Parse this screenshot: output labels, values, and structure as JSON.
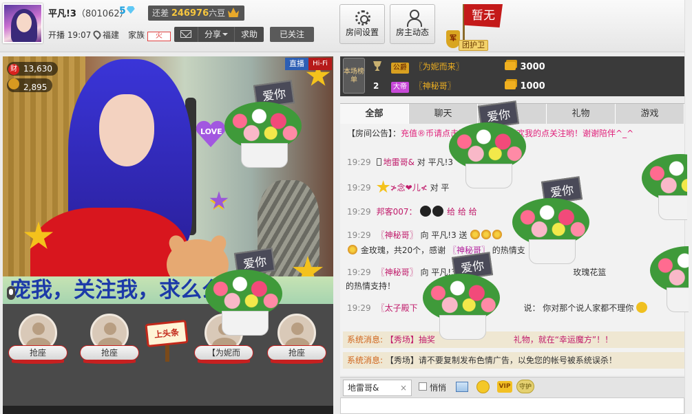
{
  "anchor": {
    "name": "平凡!3",
    "id": "（801062）",
    "level": "5",
    "goal_prefix": "还差",
    "goal_number": "246976",
    "goal_suffix": "六豆",
    "start_time": "开播 19:07",
    "location": "福建",
    "family_label": "家族",
    "family_tag": "火",
    "actions": {
      "share": "分享",
      "help": "求助"
    },
    "followed": "已关注"
  },
  "toolbar": {
    "room_settings": "房间设置",
    "host_feed": "房主动态"
  },
  "flag": {
    "text": "暂无"
  },
  "guard": {
    "badge": "军",
    "label": "团护卫"
  },
  "video": {
    "stat_wealth_badge": "财",
    "stat_wealth": "13,630",
    "stat_fans": "2,895",
    "live": "直播",
    "hifi": "Hi-Fi",
    "heart_text": "LOVE",
    "marquee": "宠我，关注我，求么么"
  },
  "seats": {
    "grab": "抢座",
    "headline": "上头条",
    "seat4_label": "【为妮而"
  },
  "rank": {
    "medal": "本场榜单",
    "rows": [
      {
        "num": "",
        "badge": "公爵",
        "user": "〖为妮而来〗",
        "score": "3000"
      },
      {
        "num": "2",
        "badge": "大帝",
        "user": "〖神秘哥〗",
        "score": "1000"
      }
    ]
  },
  "tabs": [
    "全部",
    "聊天",
    "",
    "礼物",
    "游戏"
  ],
  "chat": {
    "announce_label": "【房间公告】：",
    "announce_text": "充值®币请点击这里进行……喜欢我的点关注哟！谢谢陪伴^_^",
    "messages": [
      {
        "time": "19:29",
        "user": "地雷哥&",
        "text": "对 平凡!3"
      },
      {
        "time": "19:29",
        "user": "≯念❤儿≮",
        "text": "对 平"
      },
      {
        "time": "19:29",
        "user": "邦客007：",
        "text": "给 给 给"
      },
      {
        "time": "19:29",
        "user": "〖神秘哥〗",
        "text": "向 平凡!3 送"
      },
      {
        "time": "",
        "user": "〖神秘哥〗",
        "text": "金玫瑰，共20个，感谢",
        "suffix": "的热情支"
      },
      {
        "time": "19:29",
        "user": "〖神秘哥〗",
        "text": "向 平凡!3 送",
        "suffix": "玫瑰花篮"
      },
      {
        "time": "",
        "user": "",
        "text": "的热情支持！"
      },
      {
        "time": "19:29",
        "user": "〖太子殿下",
        "text": "说：",
        "suffix": "你对那个说人家都不理你"
      }
    ],
    "sys1": {
      "label": "系统消息:",
      "text": "【秀场】抽奖",
      "gift": "礼物，就在“幸运魔方”！！"
    },
    "sys2": {
      "label": "系统消息:",
      "text": "【秀场】请不要复制发布色情广告，以免您的帐号被系统误杀！"
    }
  },
  "input": {
    "target": "地雷哥&",
    "close": "×",
    "private": "悄悄",
    "vip": "VIP",
    "guard": "守护"
  },
  "gift_sign": "爱你"
}
